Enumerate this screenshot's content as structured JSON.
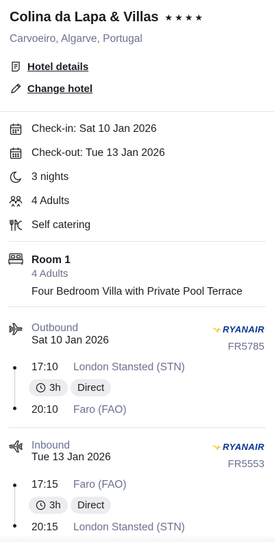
{
  "hotel": {
    "name": "Colina da Lapa & Villas",
    "star_rating": 4,
    "location": "Carvoeiro, Algarve, Portugal"
  },
  "links": {
    "hotel_details": "Hotel details",
    "change_hotel": "Change hotel"
  },
  "stay": {
    "check_in": "Check-in: Sat 10 Jan 2026",
    "check_out": "Check-out: Tue 13 Jan 2026",
    "nights": "3 nights",
    "guests": "4 Adults",
    "board": "Self catering"
  },
  "room": {
    "title": "Room 1",
    "adults": "4 Adults",
    "type": "Four Bedroom Villa with Private Pool Terrace"
  },
  "outbound": {
    "label": "Outbound",
    "date": "Sat 10 Jan 2026",
    "airline": "RYANAIR",
    "flight_number": "FR5785",
    "depart_time": "17:10",
    "depart_airport": "London Stansted (STN)",
    "duration": "3h",
    "stops": "Direct",
    "arrive_time": "20:10",
    "arrive_airport": "Faro (FAO)"
  },
  "inbound": {
    "label": "Inbound",
    "date": "Tue 13 Jan 2026",
    "airline": "RYANAIR",
    "flight_number": "FR5553",
    "depart_time": "17:15",
    "depart_airport": "Faro (FAO)",
    "duration": "3h",
    "stops": "Direct",
    "arrive_time": "20:15",
    "arrive_airport": "London Stansted (STN)"
  },
  "icons": [
    "star-icon",
    "document-icon",
    "pencil-icon",
    "calendar-icon",
    "moon-icon",
    "people-icon",
    "cutlery-icon",
    "bed-icon",
    "plane-icon",
    "clock-icon"
  ],
  "colors": {
    "text": "#1c1c24",
    "muted": "#6b7090",
    "pill_bg": "#ececf0",
    "divider": "#e4e4ea",
    "ryanair_blue": "#073590",
    "ryanair_gold": "#f1c933"
  }
}
